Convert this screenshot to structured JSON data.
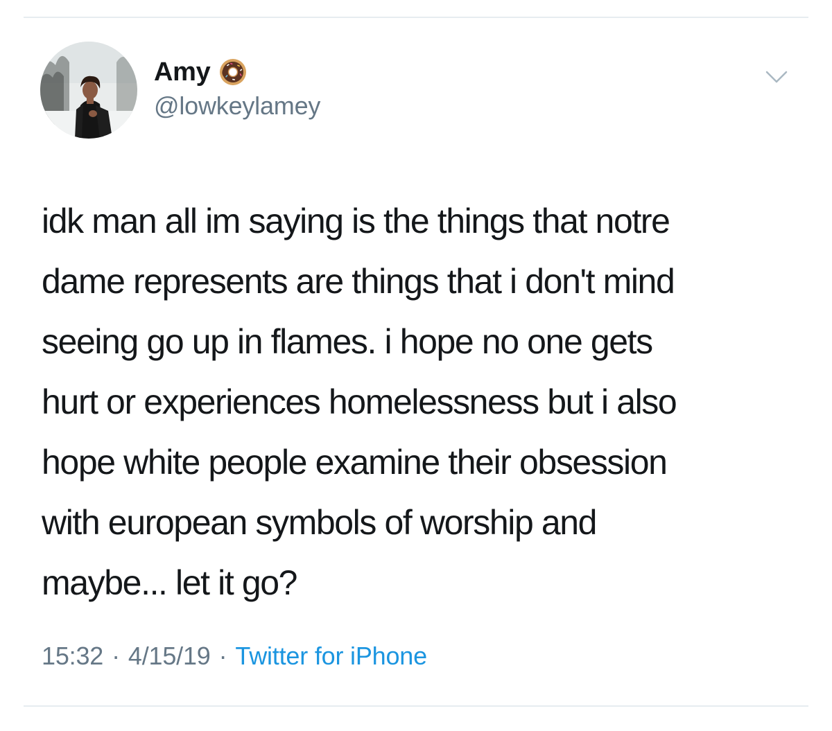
{
  "tweet": {
    "author": {
      "display_name": "Amy",
      "name_emoji": "donut-icon",
      "handle": "@lowkeylamey"
    },
    "menu_icon": "chevron-down-icon",
    "text": "idk man all im saying is the things that notre\ndame represents are things that i don't mind\nseeing go up in flames. i hope no one gets\nhurt or experiences homelessness but i also\nhope white people examine their obsession\nwith european symbols of worship and\nmaybe... let it go?",
    "time": "15:32",
    "date": "4/15/19",
    "separator": "·",
    "source": "Twitter for iPhone"
  },
  "colors": {
    "text": "#14171a",
    "secondary": "#657786",
    "link": "#1b95e0",
    "divider": "#e6ecf0"
  }
}
